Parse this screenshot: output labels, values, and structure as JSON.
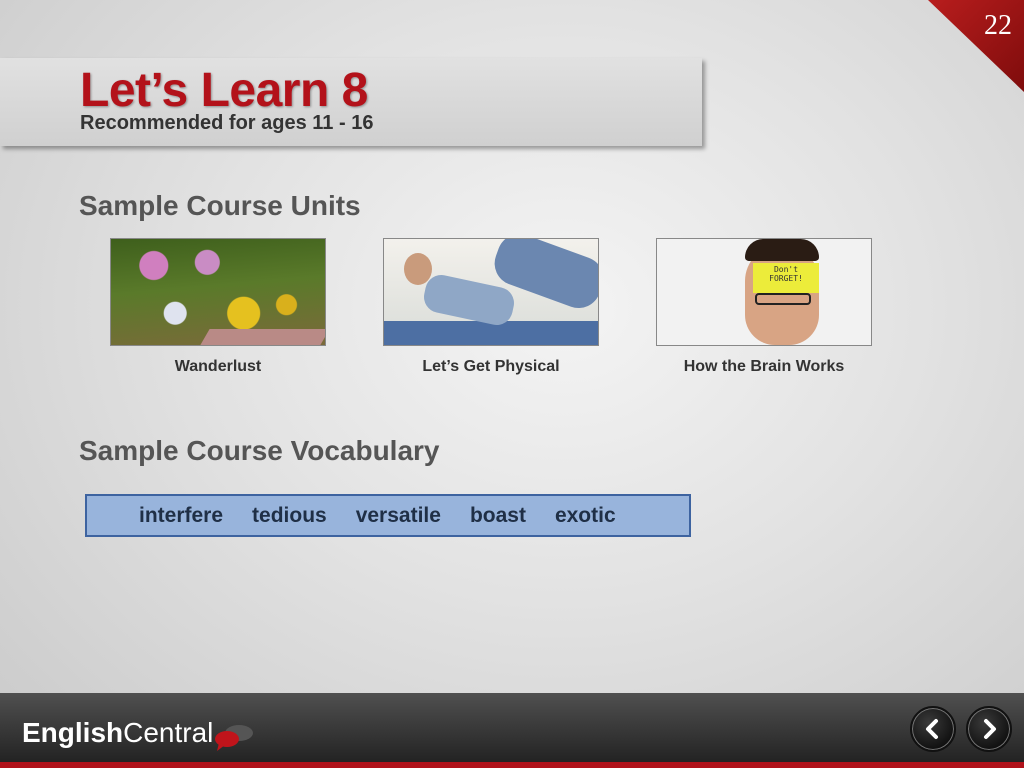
{
  "slide_number": "22",
  "header": {
    "title": "Let’s Learn 8",
    "subtitle": "Recommended for ages 11 - 16"
  },
  "units": {
    "heading": "Sample Course Units",
    "items": [
      {
        "label": "Wanderlust"
      },
      {
        "label": "Let’s Get Physical"
      },
      {
        "label": "How the Brain Works",
        "note_text": "Don't FORGET!"
      }
    ]
  },
  "vocabulary": {
    "heading": "Sample Course Vocabulary",
    "words": [
      "interfere",
      "tedious",
      "versatile",
      "boast",
      "exotic"
    ]
  },
  "footer": {
    "logo_bold": "English",
    "logo_light": "Central",
    "prev_icon": "chevron-left-icon",
    "next_icon": "chevron-right-icon"
  },
  "colors": {
    "title_red": "#b3121a",
    "corner_red": "#b81d1d",
    "vocab_bg": "#98b4dc",
    "vocab_border": "#3d63a0"
  }
}
